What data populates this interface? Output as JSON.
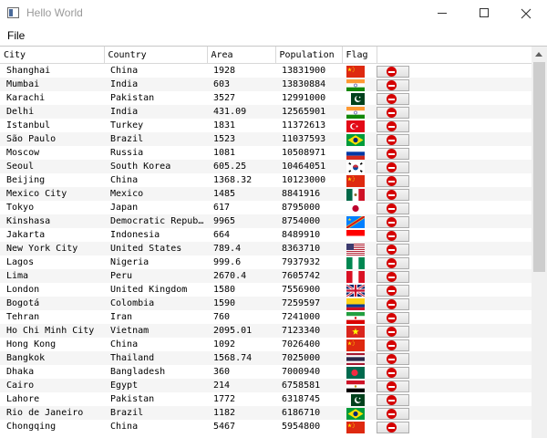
{
  "window": {
    "title": "Hello World"
  },
  "menu": {
    "file": "File"
  },
  "table": {
    "headers": {
      "city": "City",
      "country": "Country",
      "area": "Area",
      "population": "Population",
      "flag": "Flag"
    },
    "rows": [
      {
        "city": "Shanghai",
        "country": "China",
        "area": "1928",
        "population": "13831900",
        "flag": "china-flag-icon"
      },
      {
        "city": "Mumbai",
        "country": "India",
        "area": "603",
        "population": "13830884",
        "flag": "india-flag-icon"
      },
      {
        "city": "Karachi",
        "country": "Pakistan",
        "area": "3527",
        "population": "12991000",
        "flag": "pakistan-flag-icon"
      },
      {
        "city": "Delhi",
        "country": "India",
        "area": "431.09",
        "population": "12565901",
        "flag": "india-flag-icon"
      },
      {
        "city": "Istanbul",
        "country": "Turkey",
        "area": "1831",
        "population": "11372613",
        "flag": "turkey-flag-icon"
      },
      {
        "city": "São Paulo",
        "country": "Brazil",
        "area": "1523",
        "population": "11037593",
        "flag": "brazil-flag-icon"
      },
      {
        "city": "Moscow",
        "country": "Russia",
        "area": "1081",
        "population": "10508971",
        "flag": "russia-flag-icon"
      },
      {
        "city": "Seoul",
        "country": "South Korea",
        "area": "605.25",
        "population": "10464051",
        "flag": "south-korea-flag-icon"
      },
      {
        "city": "Beijing",
        "country": "China",
        "area": "1368.32",
        "population": "10123000",
        "flag": "china-flag-icon"
      },
      {
        "city": "Mexico City",
        "country": "Mexico",
        "area": "1485",
        "population": "8841916",
        "flag": "mexico-flag-icon"
      },
      {
        "city": "Tokyo",
        "country": "Japan",
        "area": "617",
        "population": "8795000",
        "flag": "japan-flag-icon"
      },
      {
        "city": "Kinshasa",
        "country": "Democratic Repub…",
        "area": "9965",
        "population": "8754000",
        "flag": "dr-congo-flag-icon"
      },
      {
        "city": "Jakarta",
        "country": "Indonesia",
        "area": "664",
        "population": "8489910",
        "flag": "indonesia-flag-icon"
      },
      {
        "city": "New York City",
        "country": "United States",
        "area": "789.4",
        "population": "8363710",
        "flag": "usa-flag-icon"
      },
      {
        "city": "Lagos",
        "country": "Nigeria",
        "area": "999.6",
        "population": "7937932",
        "flag": "nigeria-flag-icon"
      },
      {
        "city": "Lima",
        "country": "Peru",
        "area": "2670.4",
        "population": "7605742",
        "flag": "peru-flag-icon"
      },
      {
        "city": "London",
        "country": "United Kingdom",
        "area": "1580",
        "population": "7556900",
        "flag": "uk-flag-icon"
      },
      {
        "city": "Bogotá",
        "country": "Colombia",
        "area": "1590",
        "population": "7259597",
        "flag": "colombia-flag-icon"
      },
      {
        "city": "Tehran",
        "country": "Iran",
        "area": "760",
        "population": "7241000",
        "flag": "iran-flag-icon"
      },
      {
        "city": "Ho Chi Minh City",
        "country": "Vietnam",
        "area": "2095.01",
        "population": "7123340",
        "flag": "vietnam-flag-icon"
      },
      {
        "city": "Hong Kong",
        "country": "China",
        "area": "1092",
        "population": "7026400",
        "flag": "china-flag-icon"
      },
      {
        "city": "Bangkok",
        "country": "Thailand",
        "area": "1568.74",
        "population": "7025000",
        "flag": "thailand-flag-icon"
      },
      {
        "city": "Dhaka",
        "country": "Bangladesh",
        "area": "360",
        "population": "7000940",
        "flag": "bangladesh-flag-icon"
      },
      {
        "city": "Cairo",
        "country": "Egypt",
        "area": "214",
        "population": "6758581",
        "flag": "egypt-flag-icon"
      },
      {
        "city": "Lahore",
        "country": "Pakistan",
        "area": "1772",
        "population": "6318745",
        "flag": "pakistan-flag-icon"
      },
      {
        "city": "Rio de Janeiro",
        "country": "Brazil",
        "area": "1182",
        "population": "6186710",
        "flag": "brazil-flag-icon"
      },
      {
        "city": "Chongqing",
        "country": "China",
        "area": "5467",
        "population": "5954800",
        "flag": "china-flag-icon"
      }
    ]
  },
  "icons": {
    "window_icon": "app-window-icon",
    "delete": "delete-icon",
    "minimize": "minimize-icon",
    "maximize": "maximize-icon",
    "close": "close-icon"
  },
  "colors": {
    "delete_icon": "#d40000",
    "alt_row": "#f5f5f5",
    "scroll_thumb": "#cdcdcd"
  }
}
